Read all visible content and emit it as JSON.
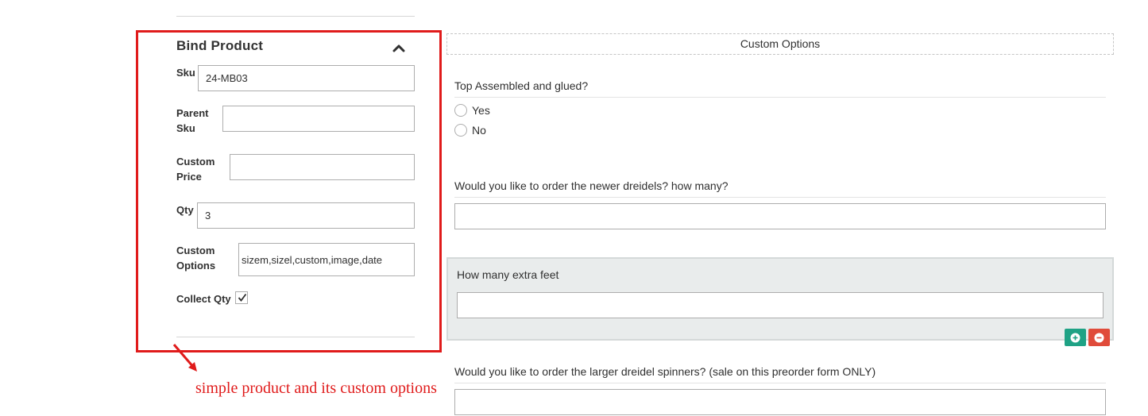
{
  "bind_product": {
    "title": "Bind Product",
    "fields": {
      "sku": {
        "label": "Sku",
        "value": "24-MB03"
      },
      "parent_sku": {
        "label_line1": "Parent",
        "label_line2": "Sku",
        "value": ""
      },
      "custom_price": {
        "label_line1": "Custom",
        "label_line2": "Price",
        "value": ""
      },
      "qty": {
        "label": "Qty",
        "value": "3"
      },
      "custom_options": {
        "label_line1": "Custom",
        "label_line2": "Options",
        "value": "sizem,sizel,custom,image,date"
      },
      "collect_qty": {
        "label": "Collect Qty",
        "checked": true
      }
    }
  },
  "annotation": {
    "text": "simple product and its custom options",
    "color": "#e01b1b"
  },
  "custom_options": {
    "header": "Custom Options",
    "q1": {
      "text": "Top Assembled and glued?",
      "options": [
        "Yes",
        "No"
      ]
    },
    "q2": {
      "text": "Would you like to order the newer dreidels? how many?",
      "value": ""
    },
    "q3": {
      "text": "How many extra feet",
      "value": ""
    },
    "q4": {
      "text": "Would you like to order the larger dreidel spinners? (sale on this preorder form ONLY)",
      "value": ""
    }
  },
  "colors": {
    "add_button": "#1fa285",
    "remove_button": "#e04b3a",
    "highlight": "#e01b1b"
  },
  "icons": [
    "chevron-up-icon",
    "checkmark-icon",
    "plus-circle-icon",
    "minus-circle-icon",
    "arrow-icon"
  ]
}
